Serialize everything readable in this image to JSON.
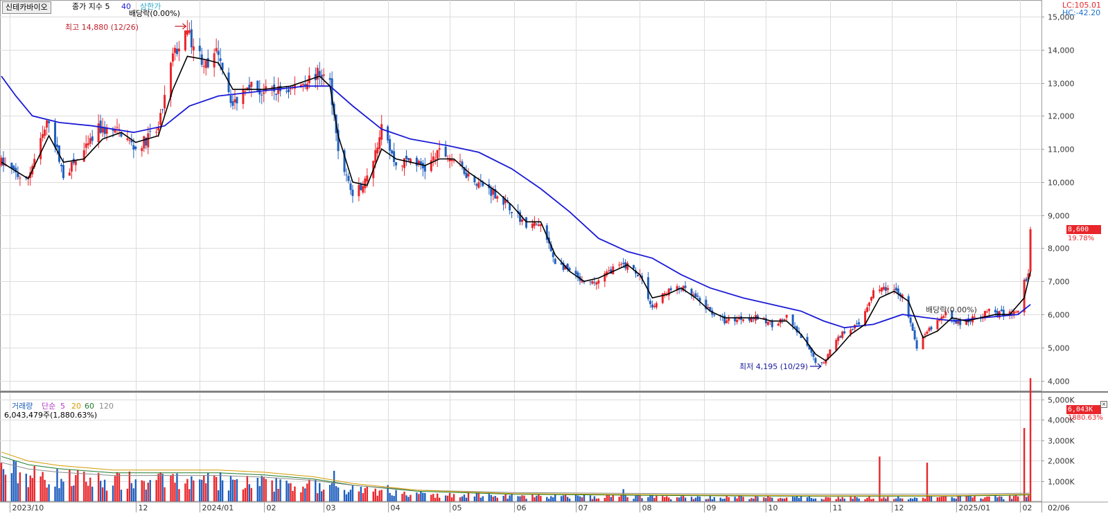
{
  "stock": {
    "name": "신테카바이오"
  },
  "price_panel": {
    "indicator_label": "종가 지수 5",
    "ma_period_2": "40",
    "upper_limit_label": "상한가",
    "dividend_label": "배당락(0.00%)",
    "dividend_label_2": "배당락(0.00%)",
    "high_marker": "최고 14,880 (12/26)",
    "low_marker": "최저 4,195 (10/29)",
    "lc_label": "LC:105.01",
    "hc_label": "HC:-42.20",
    "current_price": "8,600",
    "current_change": "19.78%",
    "y_ticks": [
      "15,000",
      "14,000",
      "13,000",
      "12,000",
      "11,000",
      "10,000",
      "9,000",
      "8,000",
      "7,000",
      "6,000",
      "5,000",
      "4,000"
    ]
  },
  "volume_panel": {
    "title": "거래량",
    "ma_label": "단순",
    "ma_periods": [
      "5",
      "20",
      "60",
      "120"
    ],
    "current_volume": "6,043,479주(1,880.63%)",
    "current_tag": "6,043K",
    "current_change": "1880.63%",
    "y_ticks": [
      "5,000K",
      "4,000K",
      "3,000K",
      "2,000K",
      "1,000K"
    ]
  },
  "x_axis": {
    "labels": [
      "2023/10",
      "12",
      "2024/01",
      "02",
      "03",
      "04",
      "05",
      "06",
      "07",
      "08",
      "09",
      "10",
      "11",
      "12",
      "2025/01",
      "02",
      "02/06"
    ]
  },
  "colors": {
    "up": "#e8262b",
    "down": "#1f5fbf",
    "ma5": "#000000",
    "ma40": "#1a1ad6",
    "vol_ma5": "#b23bc4",
    "vol_ma20": "#d49a00",
    "vol_ma60": "#1d7a2a",
    "vol_ma120": "#8a8a8a",
    "grid": "#dcdcdc"
  },
  "chart_data": [
    {
      "type": "line",
      "title": "종가 지수 5 / 40",
      "ylim": [
        3700,
        15250
      ],
      "price_path": [
        [
          "2023-09-27",
          10600
        ],
        [
          "2023-10-09",
          10000
        ],
        [
          "2023-10-20",
          11900
        ],
        [
          "2023-10-27",
          10200
        ],
        [
          "2023-11-06",
          10900
        ],
        [
          "2023-11-13",
          11600
        ],
        [
          "2023-11-24",
          11500
        ],
        [
          "2023-12-01",
          11000
        ],
        [
          "2023-12-12",
          11600
        ],
        [
          "2023-12-19",
          13800
        ],
        [
          "2023-12-26",
          14500
        ],
        [
          "2024-01-05",
          13400
        ],
        [
          "2024-01-10",
          14000
        ],
        [
          "2024-01-17",
          12300
        ],
        [
          "2024-01-24",
          13000
        ],
        [
          "2024-01-31",
          12700
        ],
        [
          "2024-02-14",
          12800
        ],
        [
          "2024-02-28",
          13300
        ],
        [
          "2024-03-04",
          13000
        ],
        [
          "2024-03-08",
          11000
        ],
        [
          "2024-03-15",
          9600
        ],
        [
          "2024-03-22",
          10100
        ],
        [
          "2024-03-29",
          11600
        ],
        [
          "2024-04-05",
          10500
        ],
        [
          "2024-04-12",
          10700
        ],
        [
          "2024-04-19",
          10400
        ],
        [
          "2024-04-26",
          10900
        ],
        [
          "2024-05-03",
          10700
        ],
        [
          "2024-05-10",
          10200
        ],
        [
          "2024-05-17",
          9900
        ],
        [
          "2024-05-24",
          9600
        ],
        [
          "2024-05-31",
          9200
        ],
        [
          "2024-06-07",
          8700
        ],
        [
          "2024-06-14",
          8700
        ],
        [
          "2024-06-21",
          7600
        ],
        [
          "2024-06-28",
          7300
        ],
        [
          "2024-07-05",
          6900
        ],
        [
          "2024-07-12",
          7000
        ],
        [
          "2024-07-19",
          7400
        ],
        [
          "2024-07-26",
          7500
        ],
        [
          "2024-08-01",
          7200
        ],
        [
          "2024-08-07",
          6200
        ],
        [
          "2024-08-14",
          6700
        ],
        [
          "2024-08-21",
          6800
        ],
        [
          "2024-08-28",
          6500
        ],
        [
          "2024-09-04",
          6100
        ],
        [
          "2024-09-11",
          5800
        ],
        [
          "2024-09-20",
          5900
        ],
        [
          "2024-09-27",
          5900
        ],
        [
          "2024-10-04",
          5700
        ],
        [
          "2024-10-11",
          5900
        ],
        [
          "2024-10-18",
          5300
        ],
        [
          "2024-10-25",
          4600
        ],
        [
          "2024-10-29",
          4500
        ],
        [
          "2024-11-01",
          5000
        ],
        [
          "2024-11-08",
          5500
        ],
        [
          "2024-11-15",
          5700
        ],
        [
          "2024-11-22",
          6700
        ],
        [
          "2024-11-29",
          6800
        ],
        [
          "2024-12-06",
          6600
        ],
        [
          "2024-12-13",
          5000
        ],
        [
          "2024-12-20",
          5600
        ],
        [
          "2024-12-27",
          6000
        ],
        [
          "2025-01-03",
          5700
        ],
        [
          "2025-01-10",
          5900
        ],
        [
          "2025-01-17",
          6100
        ],
        [
          "2025-01-24",
          6000
        ],
        [
          "2025-01-31",
          6100
        ],
        [
          "2025-02-03",
          7000
        ],
        [
          "2025-02-04",
          7100
        ],
        [
          "2025-02-05",
          7200
        ],
        [
          "2025-02-06",
          8600
        ]
      ],
      "ma5_path": [
        [
          "2023-09-27",
          10600
        ],
        [
          "2023-10-10",
          10100
        ],
        [
          "2023-10-20",
          11400
        ],
        [
          "2023-10-27",
          10600
        ],
        [
          "2023-11-06",
          10700
        ],
        [
          "2023-11-15",
          11300
        ],
        [
          "2023-11-24",
          11500
        ],
        [
          "2023-12-01",
          11200
        ],
        [
          "2023-12-12",
          11400
        ],
        [
          "2023-12-19",
          12800
        ],
        [
          "2023-12-26",
          13800
        ],
        [
          "2024-01-04",
          13700
        ],
        [
          "2024-01-10",
          13600
        ],
        [
          "2024-01-17",
          12800
        ],
        [
          "2024-01-24",
          12800
        ],
        [
          "2024-02-01",
          12800
        ],
        [
          "2024-02-14",
          12900
        ],
        [
          "2024-02-28",
          13200
        ],
        [
          "2024-03-04",
          12900
        ],
        [
          "2024-03-08",
          11400
        ],
        [
          "2024-03-15",
          10000
        ],
        [
          "2024-03-22",
          9900
        ],
        [
          "2024-03-29",
          11000
        ],
        [
          "2024-04-05",
          10700
        ],
        [
          "2024-04-12",
          10600
        ],
        [
          "2024-04-19",
          10500
        ],
        [
          "2024-04-26",
          10700
        ],
        [
          "2024-05-03",
          10700
        ],
        [
          "2024-05-10",
          10300
        ],
        [
          "2024-05-17",
          10000
        ],
        [
          "2024-05-24",
          9700
        ],
        [
          "2024-05-31",
          9300
        ],
        [
          "2024-06-07",
          8800
        ],
        [
          "2024-06-14",
          8800
        ],
        [
          "2024-06-21",
          7800
        ],
        [
          "2024-06-28",
          7300
        ],
        [
          "2024-07-05",
          7000
        ],
        [
          "2024-07-12",
          7100
        ],
        [
          "2024-07-19",
          7300
        ],
        [
          "2024-07-26",
          7500
        ],
        [
          "2024-08-01",
          7200
        ],
        [
          "2024-08-07",
          6500
        ],
        [
          "2024-08-14",
          6600
        ],
        [
          "2024-08-21",
          6800
        ],
        [
          "2024-08-28",
          6500
        ],
        [
          "2024-09-04",
          6100
        ],
        [
          "2024-09-11",
          5900
        ],
        [
          "2024-09-20",
          5900
        ],
        [
          "2024-09-27",
          5900
        ],
        [
          "2024-10-04",
          5800
        ],
        [
          "2024-10-11",
          5800
        ],
        [
          "2024-10-18",
          5400
        ],
        [
          "2024-10-25",
          4800
        ],
        [
          "2024-10-30",
          4600
        ],
        [
          "2024-11-04",
          4900
        ],
        [
          "2024-11-11",
          5400
        ],
        [
          "2024-11-18",
          5700
        ],
        [
          "2024-11-25",
          6500
        ],
        [
          "2024-12-02",
          6700
        ],
        [
          "2024-12-09",
          6400
        ],
        [
          "2024-12-16",
          5300
        ],
        [
          "2024-12-23",
          5500
        ],
        [
          "2024-12-30",
          5900
        ],
        [
          "2025-01-06",
          5800
        ],
        [
          "2025-01-13",
          5900
        ],
        [
          "2025-01-20",
          6000
        ],
        [
          "2025-01-27",
          6000
        ],
        [
          "2025-02-03",
          6500
        ],
        [
          "2025-02-06",
          7300
        ]
      ],
      "ma40_path": [
        [
          "2023-09-27",
          13200
        ],
        [
          "2023-10-04",
          12600
        ],
        [
          "2023-10-12",
          12000
        ],
        [
          "2023-10-25",
          11800
        ],
        [
          "2023-11-10",
          11700
        ],
        [
          "2023-11-30",
          11500
        ],
        [
          "2023-12-15",
          11700
        ],
        [
          "2023-12-27",
          12300
        ],
        [
          "2024-01-10",
          12600
        ],
        [
          "2024-01-24",
          12700
        ],
        [
          "2024-02-07",
          12800
        ],
        [
          "2024-02-21",
          12900
        ],
        [
          "2024-03-04",
          12900
        ],
        [
          "2024-03-15",
          12300
        ],
        [
          "2024-03-29",
          11600
        ],
        [
          "2024-04-12",
          11300
        ],
        [
          "2024-04-30",
          11100
        ],
        [
          "2024-05-15",
          10900
        ],
        [
          "2024-05-31",
          10400
        ],
        [
          "2024-06-14",
          9800
        ],
        [
          "2024-06-28",
          9100
        ],
        [
          "2024-07-12",
          8300
        ],
        [
          "2024-07-26",
          7900
        ],
        [
          "2024-08-07",
          7700
        ],
        [
          "2024-08-21",
          7200
        ],
        [
          "2024-09-04",
          6800
        ],
        [
          "2024-09-20",
          6500
        ],
        [
          "2024-10-04",
          6300
        ],
        [
          "2024-10-18",
          6100
        ],
        [
          "2024-10-29",
          5800
        ],
        [
          "2024-11-08",
          5600
        ],
        [
          "2024-11-22",
          5700
        ],
        [
          "2024-12-06",
          6000
        ],
        [
          "2024-12-18",
          5900
        ],
        [
          "2024-12-31",
          5800
        ],
        [
          "2025-01-14",
          5900
        ],
        [
          "2025-01-31",
          6000
        ],
        [
          "2025-02-06",
          6300
        ]
      ]
    },
    {
      "type": "bar",
      "title": "거래량",
      "ylabel": "주",
      "ylim": [
        0,
        5300000
      ],
      "volume_spikes": [
        [
          "2023-12-05",
          1000000
        ],
        [
          "2023-12-26",
          1100000
        ],
        [
          "2024-03-06",
          1500000
        ],
        [
          "2024-04-01",
          800000
        ],
        [
          "2024-07-24",
          600000
        ],
        [
          "2024-11-25",
          2200000
        ],
        [
          "2024-12-18",
          1900000
        ],
        [
          "2025-02-03",
          3600000
        ],
        [
          "2025-02-06",
          6043479
        ]
      ],
      "vol_ma60_path": [
        [
          "2023-09-27",
          2200000
        ],
        [
          "2023-10-10",
          1800000
        ],
        [
          "2023-10-25",
          1600000
        ],
        [
          "2023-11-20",
          1400000
        ],
        [
          "2023-12-20",
          1400000
        ],
        [
          "2024-01-10",
          1400000
        ],
        [
          "2024-02-01",
          1300000
        ],
        [
          "2024-02-25",
          1100000
        ],
        [
          "2024-03-15",
          800000
        ],
        [
          "2024-04-15",
          500000
        ],
        [
          "2024-06-01",
          350000
        ],
        [
          "2024-09-01",
          280000
        ],
        [
          "2024-11-01",
          250000
        ],
        [
          "2025-01-01",
          260000
        ],
        [
          "2025-02-06",
          320000
        ]
      ]
    }
  ]
}
